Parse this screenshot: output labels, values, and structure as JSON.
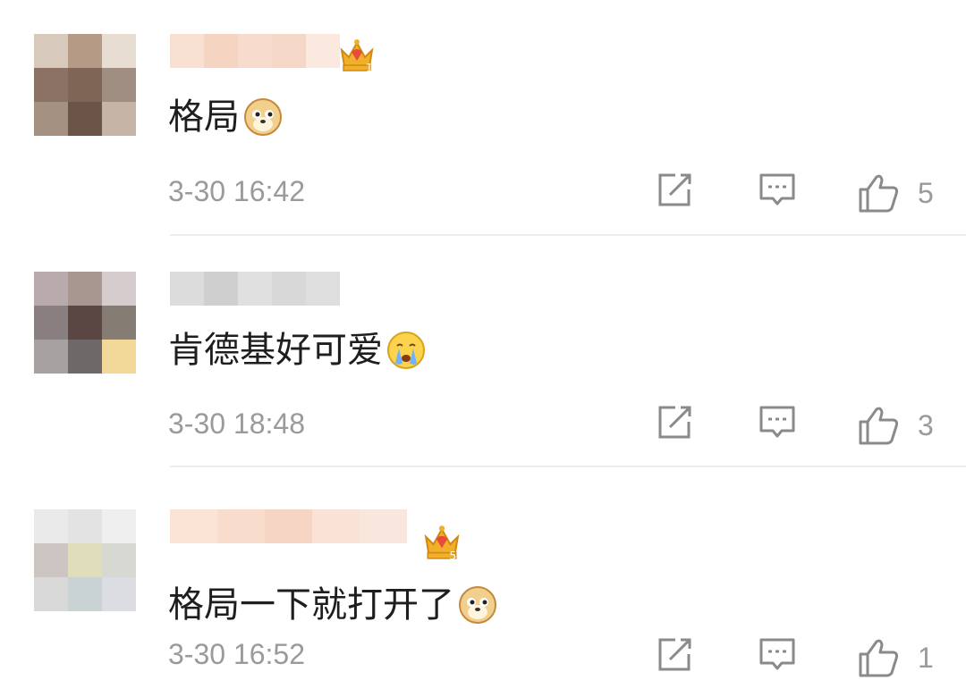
{
  "comments": [
    {
      "text": "格局",
      "emoji": "doge-emoji",
      "time": "3-30 16:42",
      "likes": "5",
      "badge": "crown-badge-level-1",
      "badge_level": "1"
    },
    {
      "text": "肯德基好可爱",
      "emoji": "crying-face-emoji",
      "time": "3-30 18:48",
      "likes": "3"
    },
    {
      "text": "格局一下就打开了",
      "emoji": "doge-emoji",
      "time": "3-30 16:52",
      "likes": "1",
      "badge": "crown-badge-level-5",
      "badge_level": "5"
    }
  ],
  "icons": {
    "share": "share-icon",
    "reply": "comment-icon",
    "like": "thumbs-up-icon"
  },
  "colors": {
    "text": "#1e1e1e",
    "meta": "#9a9a9a",
    "divider": "#ececec",
    "crown_gold": "#f2b02a",
    "crown_red": "#e84a3c"
  }
}
